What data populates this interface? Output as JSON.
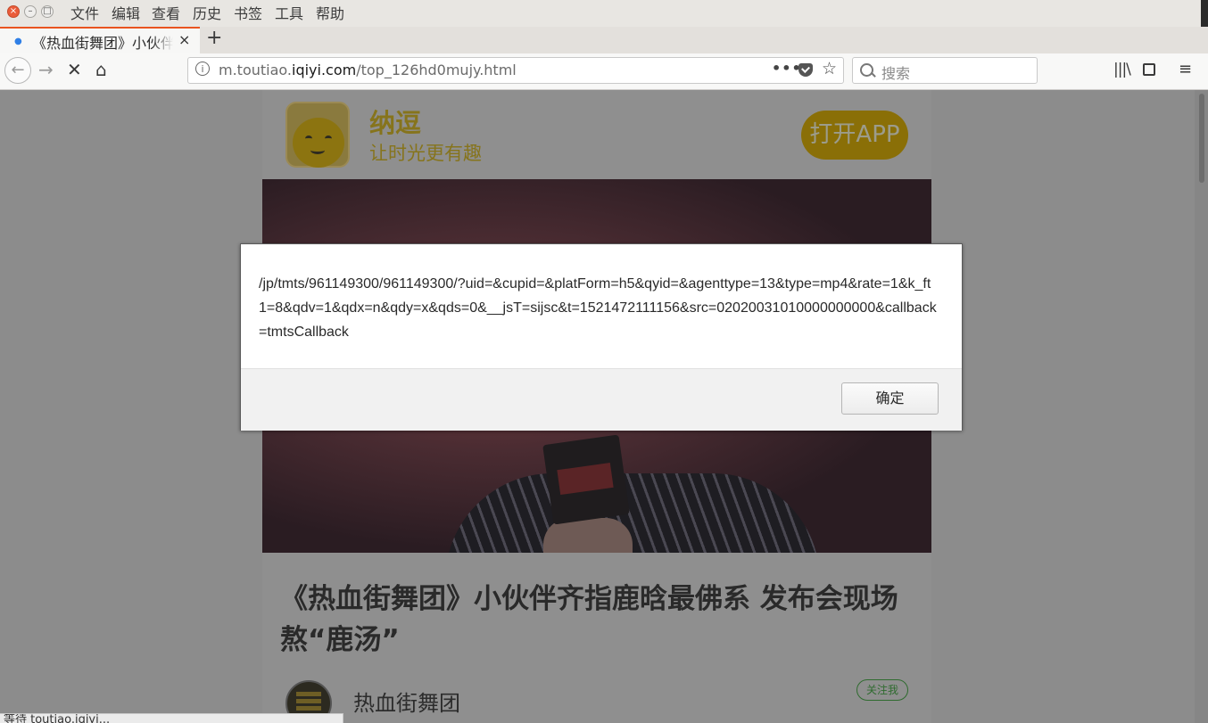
{
  "window": {
    "menu": [
      "文件",
      "编辑",
      "查看",
      "历史",
      "书签",
      "工具",
      "帮助"
    ]
  },
  "tab": {
    "title": "《热血街舞团》小伙伴齐指鹿晗最佛系 发布会现场熬“鹿汤”",
    "close_glyph": "×",
    "new_tab_glyph": "+"
  },
  "nav": {
    "url_prefix": "m.toutiao.",
    "url_domain": "iqiyi.com",
    "url_path": "/top_126hd0mujy.html",
    "more_glyph": "•••",
    "search_placeholder": "搜索",
    "icons": [
      "back-icon",
      "forward-icon",
      "stop-icon",
      "home-icon",
      "library-icon",
      "sidebar-icon",
      "hamburger-menu-icon"
    ]
  },
  "page": {
    "app_name": "纳逗",
    "app_slogan": "让时光更有趣",
    "open_app": "打开APP",
    "article_title": "《热血街舞团》小伙伴齐指鹿晗最佛系 发布会现场熬“鹿汤”",
    "author_name": "热血街舞团",
    "follow": "关注我",
    "status": "等待 toutiao.iqiyi..."
  },
  "dialog": {
    "message": "/jp/tmts/961149300/961149300/?uid=&cupid=&platForm=h5&qyid=&agenttype=13&type=mp4&rate=1&k_ft1=8&qdv=1&qdx=n&qdy=x&qds=0&__jsT=sijsc&t=1521472111156&src=02020031010000000000&callback=tmtsCallback",
    "ok_label": "确定"
  },
  "colors": {
    "accent_tab": "#e95420",
    "brand_yellow_dimmed": "#86741c",
    "overlay_gray": "#8c8c8c"
  }
}
